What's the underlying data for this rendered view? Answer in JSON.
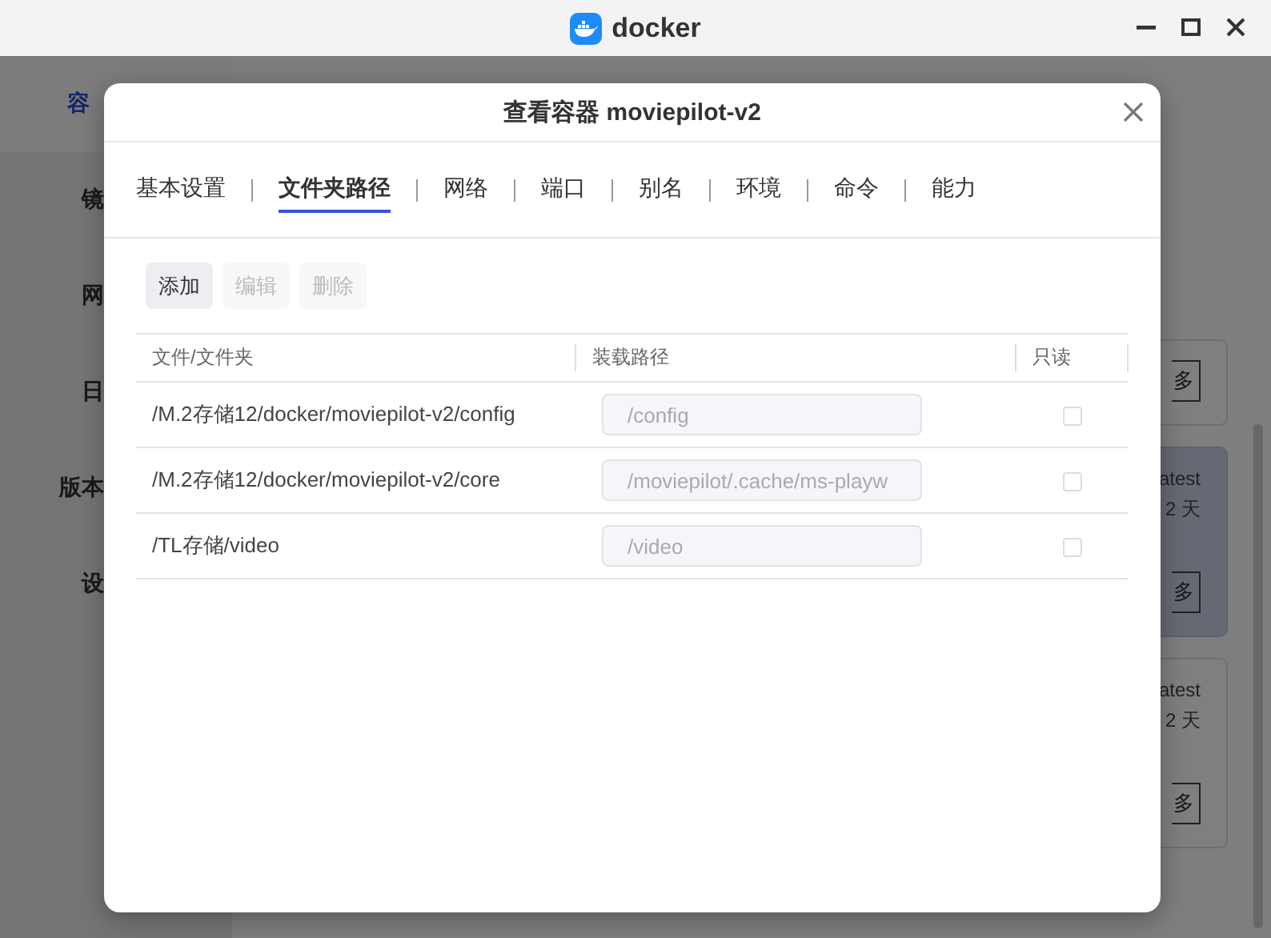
{
  "app": {
    "title": "docker"
  },
  "sidebar": {
    "items": [
      {
        "label": "容",
        "selected": true
      },
      {
        "label": "镜",
        "selected": false
      },
      {
        "label": "网",
        "selected": false
      },
      {
        "label": "日",
        "selected": false
      },
      {
        "label": "版本",
        "selected": false
      },
      {
        "label": "设",
        "selected": false
      }
    ]
  },
  "cards": [
    {
      "button": "多",
      "selected": false
    },
    {
      "lines": [
        "atest",
        "2 天"
      ],
      "button": "多",
      "selected": true
    },
    {
      "lines": [
        "atest",
        "2 天"
      ],
      "button": "多",
      "selected": false
    }
  ],
  "dialog": {
    "title": "查看容器 moviepilot-v2",
    "tabs": [
      {
        "label": "基本设置",
        "selected": false
      },
      {
        "label": "文件夹路径",
        "selected": true
      },
      {
        "label": "网络",
        "selected": false
      },
      {
        "label": "端口",
        "selected": false
      },
      {
        "label": "别名",
        "selected": false
      },
      {
        "label": "环境",
        "selected": false
      },
      {
        "label": "命令",
        "selected": false
      },
      {
        "label": "能力",
        "selected": false
      }
    ],
    "toolbar": [
      {
        "label": "添加",
        "disabled": false
      },
      {
        "label": "编辑",
        "disabled": true
      },
      {
        "label": "删除",
        "disabled": true
      }
    ],
    "table": {
      "columns": [
        "文件/文件夹",
        "装载路径",
        "只读"
      ],
      "rows": [
        {
          "path": "/M.2存储12/docker/moviepilot-v2/config",
          "mount": "/config",
          "read_only": false
        },
        {
          "path": "/M.2存储12/docker/moviepilot-v2/core",
          "mount": "/moviepilot/.cache/ms-playw",
          "read_only": false
        },
        {
          "path": "/TL存储/video",
          "mount": "/video",
          "read_only": false
        }
      ]
    }
  }
}
